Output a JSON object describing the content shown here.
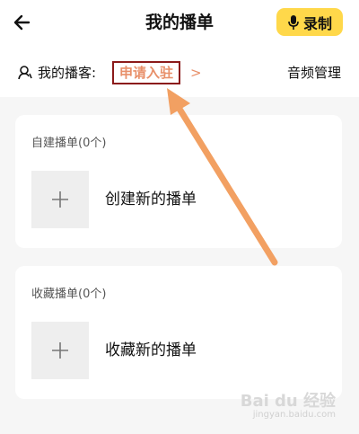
{
  "header": {
    "title": "我的播单",
    "record_label": "录制"
  },
  "subheader": {
    "my_podcast_label": "我的播客:",
    "apply_label": "申请入驻",
    "chevron": ">",
    "audio_manage_label": "音频管理"
  },
  "sections": {
    "created": {
      "title": "自建播单(0个)",
      "action": "创建新的播单"
    },
    "favorites": {
      "title": "收藏播单(0个)",
      "action": "收藏新的播单"
    }
  },
  "watermark": {
    "text": "Bai du 经验",
    "sub": "jingyan.baidu.com"
  },
  "colors": {
    "accent_yellow": "#ffd84a",
    "annotation_box": "#8b1a1a",
    "annotation_arrow": "#f2a062",
    "apply_text": "#e8906a"
  },
  "icons": {
    "back": "arrow-left-icon",
    "record": "microphone-icon",
    "person": "person-icon",
    "add": "plus-icon"
  }
}
